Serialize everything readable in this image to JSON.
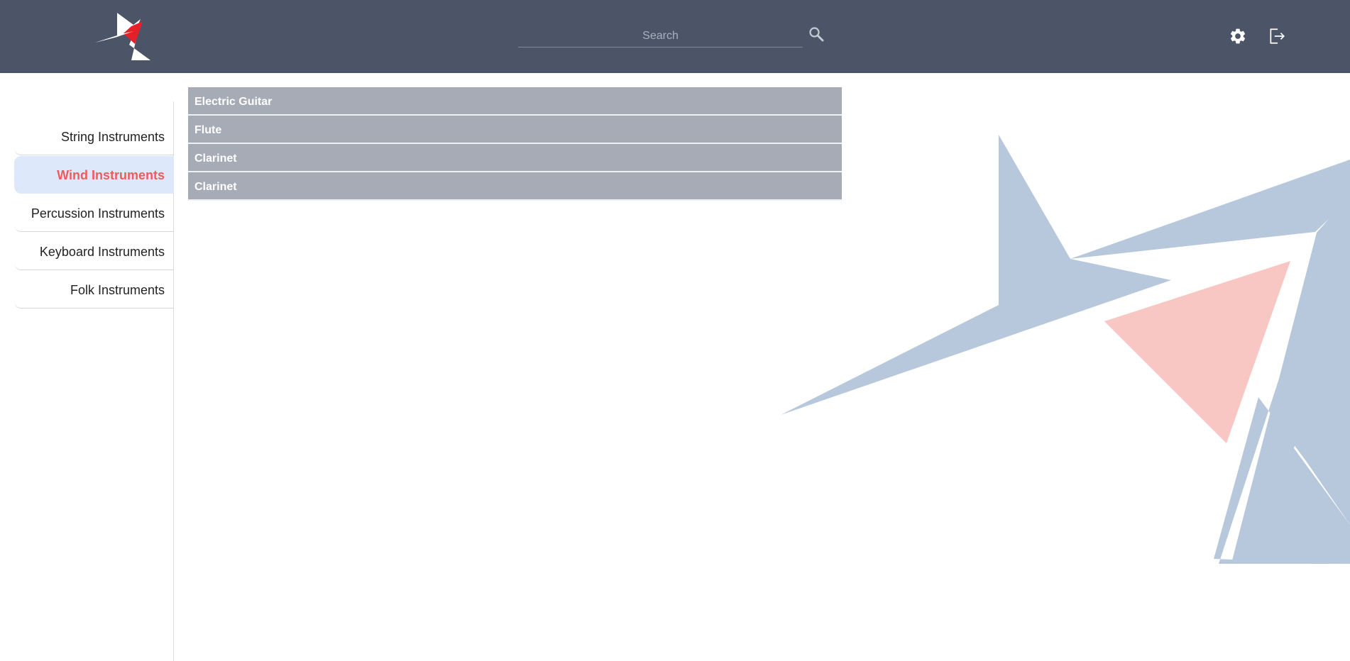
{
  "header": {
    "search": {
      "placeholder": "Search",
      "value": ""
    },
    "icons": {
      "search": "search-icon",
      "settings": "gear-icon",
      "logout": "logout-icon"
    }
  },
  "sidebar": {
    "items": [
      {
        "label": "String Instruments",
        "active": false
      },
      {
        "label": "Wind Instruments",
        "active": true
      },
      {
        "label": "Percussion Instruments",
        "active": false
      },
      {
        "label": "Keyboard Instruments",
        "active": false
      },
      {
        "label": "Folk Instruments",
        "active": false
      }
    ]
  },
  "list": {
    "items": [
      {
        "label": "Electric Guitar"
      },
      {
        "label": "Flute"
      },
      {
        "label": "Clarinet"
      },
      {
        "label": "Clarinet"
      }
    ]
  },
  "colors": {
    "header_bg": "#4b5567",
    "accent_red": "#ef5b5b",
    "active_bg": "#dde9fa",
    "list_item_bg": "#a6abb6",
    "graphic_blue": "#b8c8dc",
    "graphic_pink": "#f8c6c3"
  }
}
